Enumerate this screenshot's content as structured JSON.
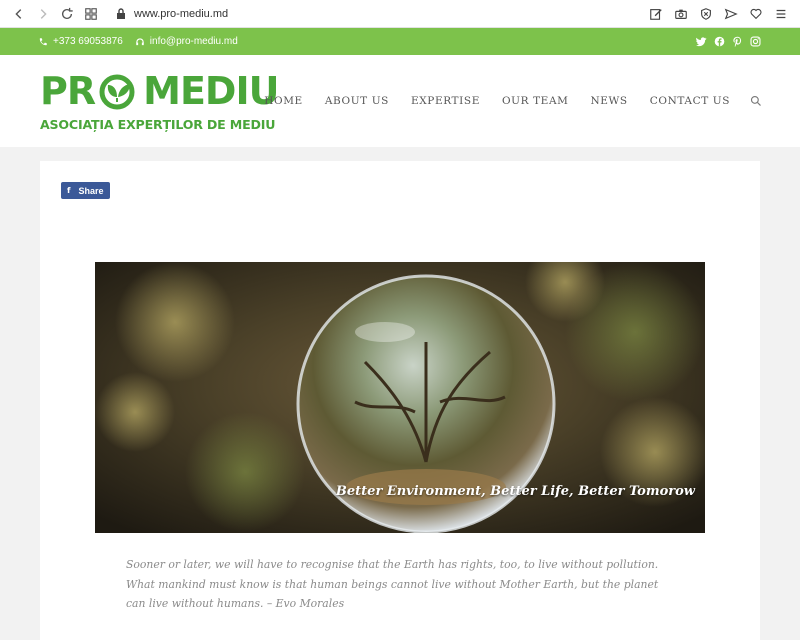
{
  "browser": {
    "url": "www.pro-mediu.md"
  },
  "topbar": {
    "phone": "+373 69053876",
    "email": "info@pro-mediu.md",
    "social": [
      "twitter-icon",
      "facebook-icon",
      "pinterest-icon",
      "instagram-icon"
    ]
  },
  "logo": {
    "word_left": "PR",
    "word_right": "MEDIU",
    "tagline": "ASOCIAȚIA EXPERȚILOR DE MEDIU"
  },
  "menu": {
    "items": [
      "HOME",
      "ABOUT US",
      "EXPERTISE",
      "OUR TEAM",
      "NEWS",
      "CONTACT US"
    ]
  },
  "content": {
    "share_label": "Share",
    "hero_caption": "Better Environment, Better Life, Better Tomorow",
    "quote": "Sooner or later, we will have to recognise that the Earth has rights, too, to live without pollution. What mankind must know is that human beings cannot live without Mother Earth, but the planet can live without humans. – Evo Morales"
  },
  "colors": {
    "brand_green": "#4aa63a",
    "topbar_green": "#7dc24b",
    "facebook_blue": "#3b5998"
  }
}
